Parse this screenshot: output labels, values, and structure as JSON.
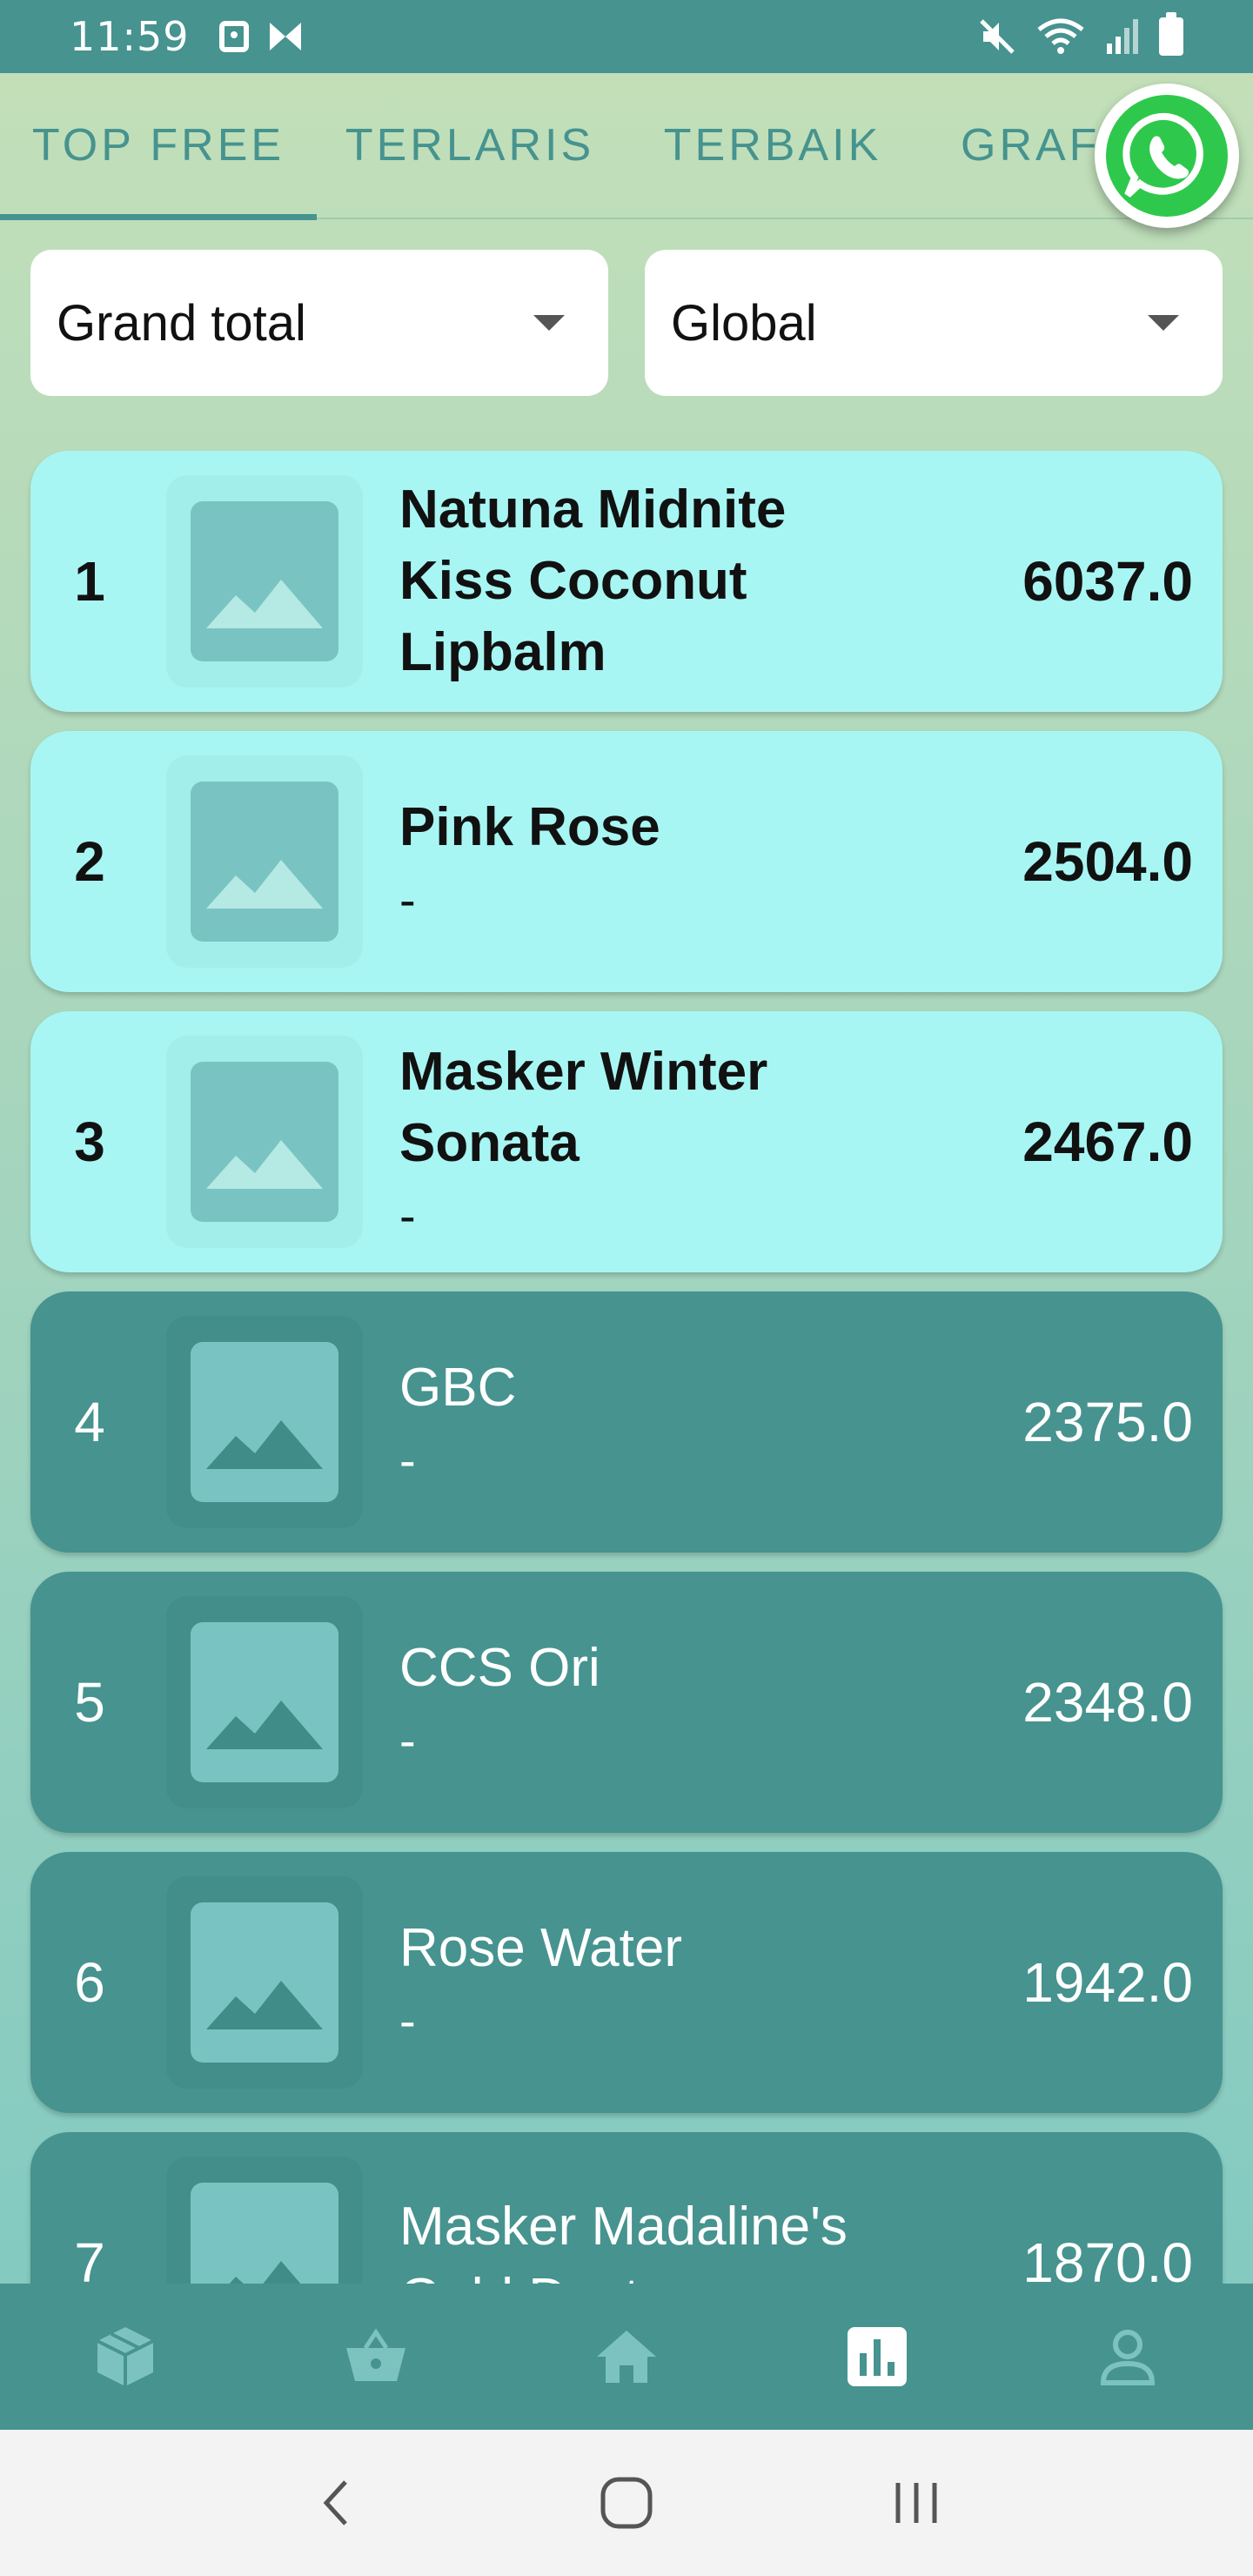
{
  "status_bar": {
    "time": "11:59"
  },
  "tabs": [
    {
      "label": "TOP FREE",
      "active": true
    },
    {
      "label": "TERLARIS",
      "active": false
    },
    {
      "label": "TERBAIK",
      "active": false
    },
    {
      "label": "GRAFIK",
      "active": false
    }
  ],
  "filters": {
    "period": "Grand total",
    "region": "Global"
  },
  "list": [
    {
      "rank": "1",
      "title": "Natuna Midnite Kiss Coconut Lipbalm",
      "subtitle": "",
      "value": "6037.0",
      "style": "light"
    },
    {
      "rank": "2",
      "title": "Pink Rose",
      "subtitle": "-",
      "value": "2504.0",
      "style": "light"
    },
    {
      "rank": "3",
      "title": "Masker Winter Sonata",
      "subtitle": "-",
      "value": "2467.0",
      "style": "light"
    },
    {
      "rank": "4",
      "title": "GBC",
      "subtitle": "-",
      "value": "2375.0",
      "style": "dark"
    },
    {
      "rank": "5",
      "title": "CCS Ori",
      "subtitle": "-",
      "value": "2348.0",
      "style": "dark"
    },
    {
      "rank": "6",
      "title": "Rose Water",
      "subtitle": "-",
      "value": "1942.0",
      "style": "dark"
    },
    {
      "rank": "7",
      "title": "Masker Madaline's Gold Dust",
      "subtitle": "",
      "value": "1870.0",
      "style": "dark"
    }
  ],
  "bottom_nav": [
    {
      "icon": "package-icon",
      "active": false
    },
    {
      "icon": "basket-icon",
      "active": false
    },
    {
      "icon": "home-icon",
      "active": false
    },
    {
      "icon": "chart-icon",
      "active": true
    },
    {
      "icon": "profile-icon",
      "active": false
    }
  ],
  "colors": {
    "primary": "#46938f",
    "card_light": "#a8f6f3",
    "whatsapp": "#2ec94c"
  }
}
